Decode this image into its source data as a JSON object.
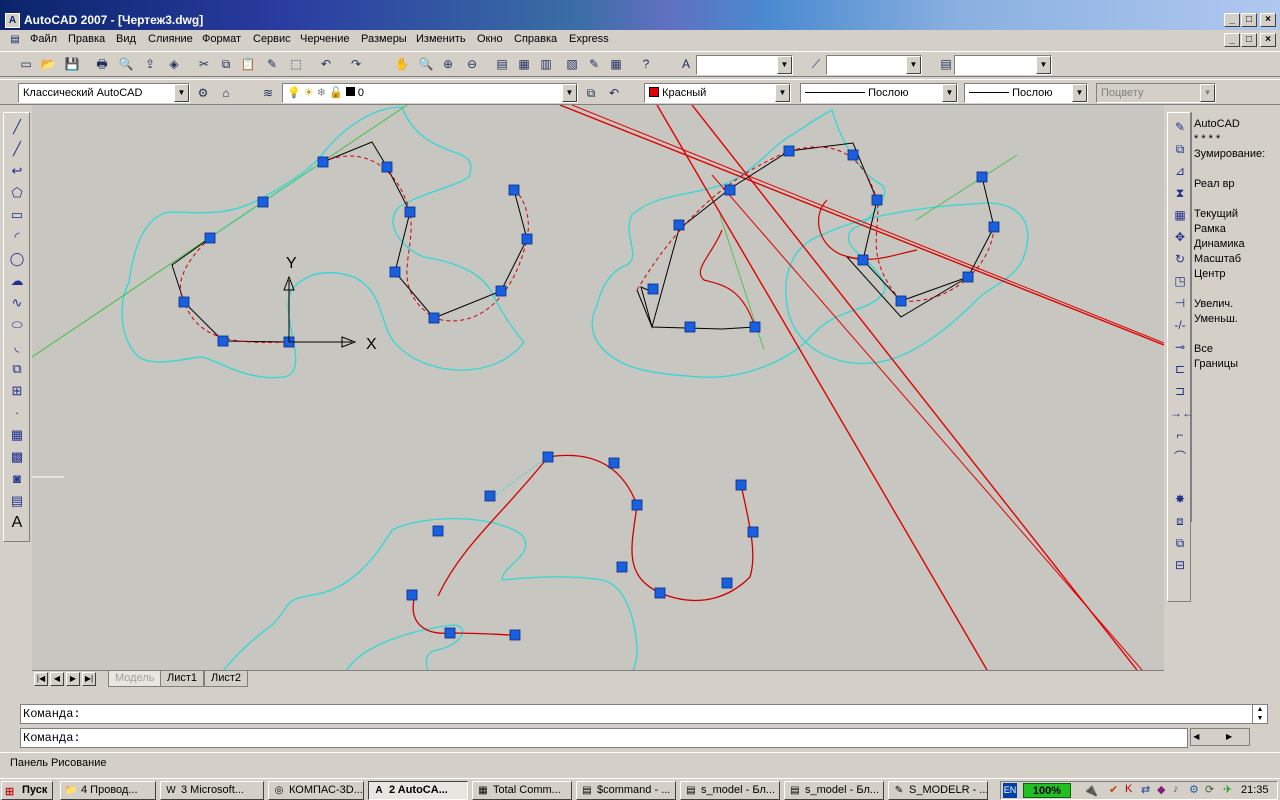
{
  "window": {
    "title": "AutoCAD 2007 - [Чертеж3.dwg]",
    "icon_label": "A"
  },
  "caption_buttons": {
    "minimize": "_",
    "maximize": "□",
    "close": "×"
  },
  "menu": {
    "items": [
      "Файл",
      "Правка",
      "Вид",
      "Слияние",
      "Формат",
      "Сервис",
      "Черчение",
      "Размеры",
      "Изменить",
      "Окно",
      "Справка",
      "Express"
    ]
  },
  "toolbar1": {
    "text_style_value": "",
    "dim_style_value": "",
    "table_style_value": "",
    "icons": [
      "new-icon",
      "open-icon",
      "save-icon",
      "plot-icon",
      "preview-icon",
      "publish-icon",
      "3d-dwf-icon",
      "cut-icon",
      "copy-icon",
      "paste-icon",
      "match-properties-icon",
      "block-editor-icon",
      "undo-icon",
      "redo-icon",
      "pan-icon",
      "zoom-realtime-icon",
      "zoom-window-icon",
      "zoom-previous-icon",
      "properties-icon",
      "design-center-icon",
      "tool-palettes-icon",
      "sheet-set-icon",
      "markup-icon",
      "quickcalc-icon",
      "help-icon",
      "text-style-icon",
      "dim-style-icon",
      "table-style-icon"
    ]
  },
  "toolbar2": {
    "workspace": "Классический AutoCAD",
    "layer": "0",
    "color": "Красный",
    "color_hex": "#e00000",
    "linetype": "Послою",
    "lineweight": "Послою",
    "plotstyle": "Поцвету"
  },
  "left_tools": [
    "line-icon",
    "construction-line-icon",
    "polyline-icon",
    "polygon-icon",
    "rectangle-icon",
    "arc-icon",
    "circle-icon",
    "revision-cloud-icon",
    "spline-icon",
    "ellipse-icon",
    "ellipse-arc-icon",
    "insert-block-icon",
    "make-block-icon",
    "point-icon",
    "hatch-icon",
    "gradient-icon",
    "region-icon",
    "table-icon",
    "mtext-icon"
  ],
  "left_tool_glyphs": [
    "╱",
    "╱",
    "↩",
    "⬠",
    "▭",
    "◜",
    "◯",
    "☁",
    "∿",
    "⬭",
    "◟",
    "⧉",
    "⊞",
    "·",
    "▦",
    "▩",
    "◙",
    "▤",
    "A"
  ],
  "right_tools": [
    "erase-icon",
    "copy-object-icon",
    "mirror-icon",
    "offset-icon",
    "array-icon",
    "move-icon",
    "rotate-icon",
    "scale-icon",
    "stretch-icon",
    "trim-icon",
    "extend-icon",
    "break-icon",
    "join-icon",
    "chamfer-icon",
    "fillet-icon",
    "explode-icon",
    "draworder-front-icon",
    "draworder-back-icon",
    "draworder-above-icon",
    "draworder-under-icon"
  ],
  "right_tool_glyphs": [
    "✎",
    "⧉",
    "⊿",
    "⧗",
    "▦",
    "✥",
    "↻",
    "◳",
    "⊣",
    "-/-",
    "⊸",
    "⊏",
    "⊐",
    "→←",
    "⌐",
    "⌒",
    "✸",
    "⧈",
    "⧉",
    "⊟"
  ],
  "zoom_panel": {
    "lines": [
      "AutoCAD",
      "* * * *",
      "Зумирование:",
      "",
      "Реал вр",
      "",
      "Текущий",
      "Рамка",
      "Динамика",
      "Масштаб",
      "Центр",
      "",
      "Увелич.",
      "Уменьш.",
      "",
      "Все",
      "Границы"
    ]
  },
  "ucs": {
    "x_label": "X",
    "y_label": "Y"
  },
  "layout_tabs": [
    "Модель",
    "Лист1",
    "Лист2"
  ],
  "nav_buttons": [
    "|◀",
    "◀",
    "▶",
    "▶|"
  ],
  "command": {
    "line1": "Команда:",
    "line2": "Команда:"
  },
  "status": {
    "text": "Панель Рисование"
  },
  "taskbar": {
    "start": "Пуск",
    "tasks": [
      {
        "label": "4 Провод...",
        "icon": "folder-icon",
        "glyph": "📁"
      },
      {
        "label": "3 Microsoft...",
        "icon": "word-icon",
        "glyph": "W"
      },
      {
        "label": "КОМПАС-3D...",
        "icon": "kompas-icon",
        "glyph": "◎"
      },
      {
        "label": "2 AutoCA...",
        "icon": "autocad-icon",
        "glyph": "A",
        "active": true
      },
      {
        "label": "Total Comm...",
        "icon": "total-commander-icon",
        "glyph": "▦"
      },
      {
        "label": "$command - ...",
        "icon": "notepad-icon",
        "glyph": "▤"
      },
      {
        "label": "s_model - Бл...",
        "icon": "notepad-icon",
        "glyph": "▤"
      },
      {
        "label": "s_model - Бл...",
        "icon": "notepad-icon",
        "glyph": "▤"
      },
      {
        "label": "S_MODELR - ...",
        "icon": "editor-icon",
        "glyph": "✎"
      }
    ],
    "tray": {
      "lang": "EN",
      "battery": "100%",
      "clock": "21:35"
    }
  },
  "drawing_colors": {
    "background": "#c8c6c0",
    "offset_curve": "#30d8d8",
    "spline": "#d00000",
    "control_polygon": "#000000",
    "grip": "#1860e0",
    "construction_line": "#40c040",
    "ray": "#e00000"
  }
}
